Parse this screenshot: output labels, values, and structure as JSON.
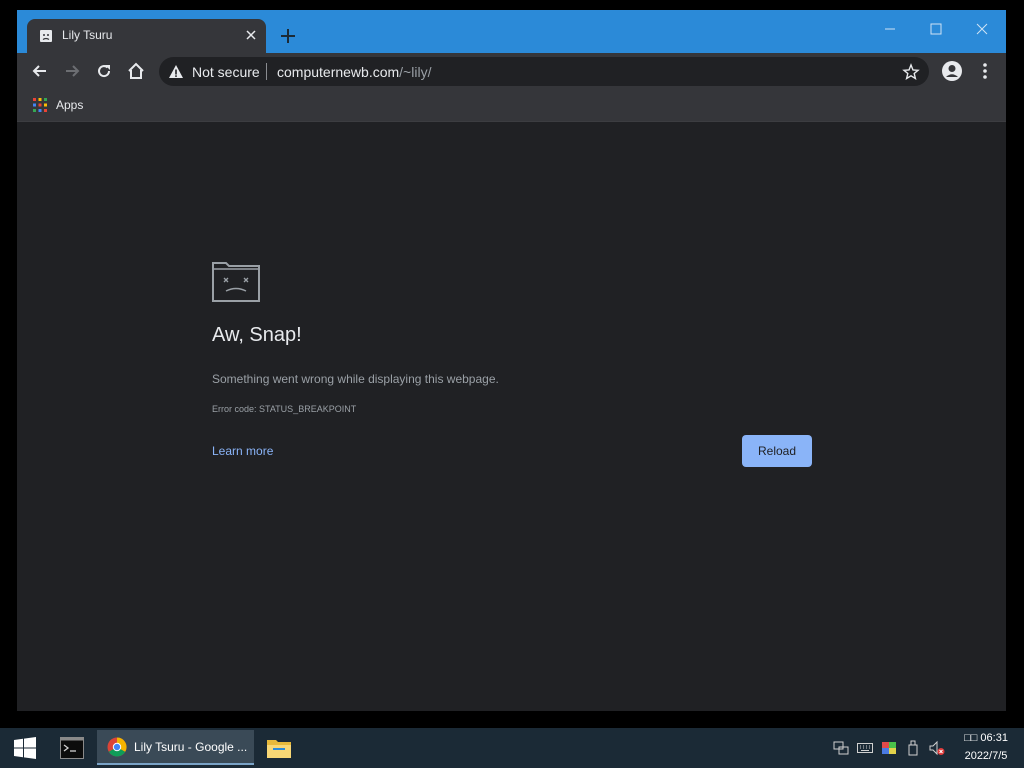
{
  "browser": {
    "tab_title": "Lily Tsuru",
    "security_label": "Not secure",
    "url_domain": "computernewb.com",
    "url_path": "/~lily/",
    "bookmarks_apps_label": "Apps"
  },
  "error_page": {
    "title": "Aw, Snap!",
    "message": "Something went wrong while displaying this webpage.",
    "error_code": "Error code: STATUS_BREAKPOINT",
    "learn_more_label": "Learn more",
    "reload_label": "Reload"
  },
  "taskbar": {
    "chrome_task_label": "Lily Tsuru - Google ...",
    "clock_time": "□□ 06:31",
    "clock_date": "2022/7/5"
  },
  "icons": [
    "sad-tab-icon",
    "close-icon",
    "plus-icon",
    "minimize-icon",
    "maximize-icon",
    "back-arrow-icon",
    "forward-arrow-icon",
    "reload-icon",
    "home-icon",
    "warning-icon",
    "star-icon",
    "account-icon",
    "menu-dots-icon",
    "apps-grid-icon",
    "sad-folder-icon",
    "windows-start-icon",
    "terminal-icon",
    "chrome-icon",
    "file-explorer-icon",
    "network-icon",
    "keyboard-icon",
    "color-icon",
    "usb-icon",
    "volume-muted-icon"
  ],
  "colors": {
    "titlebar": "#2b8ad8",
    "toolbar": "#35363a",
    "page_background": "#202124",
    "link": "#8ab4f8",
    "taskbar": "#1b2a36"
  }
}
